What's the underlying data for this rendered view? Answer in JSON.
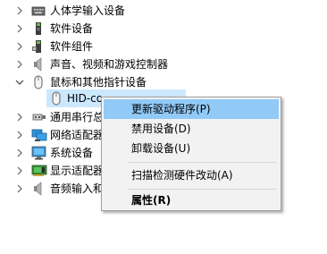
{
  "tree": {
    "items": [
      {
        "label": "人体学输入设备",
        "icon": "hid-device-icon",
        "expanded": false
      },
      {
        "label": "软件设备",
        "icon": "software-device-icon",
        "expanded": false
      },
      {
        "label": "软件组件",
        "icon": "software-component-icon",
        "expanded": false
      },
      {
        "label": "声音、视频和游戏控制器",
        "icon": "speaker-icon",
        "expanded": false
      },
      {
        "label": "鼠标和其他指针设备",
        "icon": "mouse-icon",
        "expanded": true
      },
      {
        "label": "HID-co",
        "icon": "mouse-icon",
        "child": true,
        "selected": true
      },
      {
        "label": "通用串行总",
        "icon": "usb-icon",
        "expanded": false
      },
      {
        "label": "网络适配器",
        "icon": "network-adapter-icon",
        "expanded": false
      },
      {
        "label": "系统设备",
        "icon": "system-device-icon",
        "expanded": false
      },
      {
        "label": "显示适配器",
        "icon": "display-adapter-icon",
        "expanded": false
      },
      {
        "label": "音频输入和",
        "icon": "audio-io-icon",
        "expanded": false
      }
    ]
  },
  "context_menu": {
    "items": [
      {
        "label": "更新驱动程序(P)",
        "highlighted": true
      },
      {
        "label": "禁用设备(D)"
      },
      {
        "label": "卸载设备(U)"
      },
      {
        "separator": true
      },
      {
        "label": "扫描检测硬件改动(A)"
      },
      {
        "separator": true
      },
      {
        "label": "属性(R)",
        "bold": true
      }
    ]
  },
  "colors": {
    "selection": "#cce8ff",
    "menu_highlight": "#91c9f7",
    "menu_background": "#f2f2f2"
  }
}
